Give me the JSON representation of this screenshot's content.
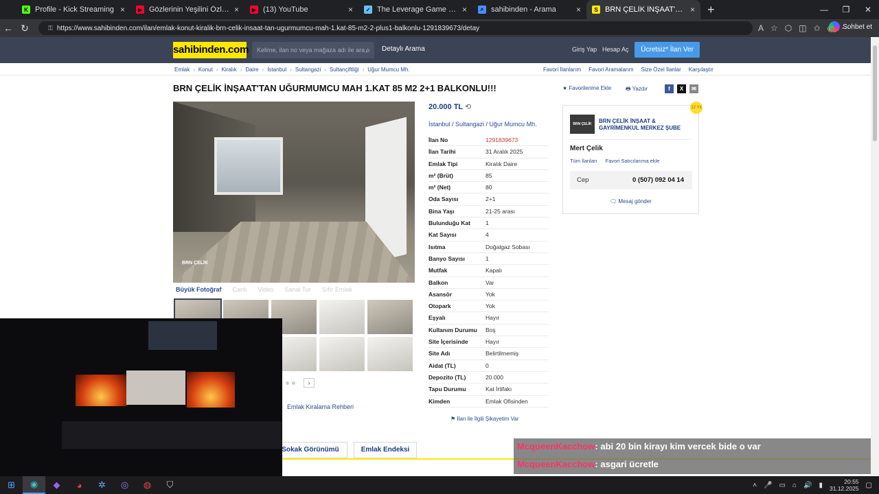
{
  "browser": {
    "tabs": [
      {
        "title": "Profile - Kick Streaming",
        "fav_color": "#53fc18",
        "fav_glyph": "K",
        "active": false
      },
      {
        "title": "Gözlerinin Yeşilini Özledim - Y",
        "fav_color": "#ff0033",
        "fav_glyph": "▶",
        "active": false
      },
      {
        "title": "(13) YouTube",
        "fav_color": "#ff0033",
        "fav_glyph": "▶",
        "active": false
      },
      {
        "title": "The Leverage Game Steam'de",
        "fav_color": "#66c0f4",
        "fav_glyph": "✓",
        "active": false
      },
      {
        "title": "sahibinden - Arama",
        "fav_color": "#4a8cff",
        "fav_glyph": "⌕",
        "active": false
      },
      {
        "title": "BRN ÇELİK İNŞAAT'TAN UĞURMU",
        "fav_color": "#ffe800",
        "fav_glyph": "S",
        "active": true
      }
    ],
    "url": "https://www.sahibinden.com/ilan/emlak-konut-kiralik-brn-celik-insaat-tan-ugurmumcu-mah-1.kat-85-m2-2-plus1-balkonlu-1291839673/detay",
    "copilot_label": "Sohbet et"
  },
  "site": {
    "logo": "sahibinden.com",
    "search_placeholder": "Kelime, ilan no veya mağaza adı ile ara",
    "detailed_search": "Detaylı Arama",
    "login": "Giriş Yap",
    "register": "Hesap Aç",
    "free_ad": "Ücretsiz* İlan Ver",
    "accent": "#ffe800",
    "header_color": "#3b4356"
  },
  "breadcrumb": [
    "Emlak",
    "Konut",
    "Kiralık",
    "Daire",
    "İstanbul",
    "Sultangazi",
    "Sultançiftliği",
    "Uğur Mumcu Mh."
  ],
  "breadcrumb_right": [
    "Favori İlanlarım",
    "Favori Aramalarım",
    "Size Özel İlanlar",
    "Karşılaştır"
  ],
  "listing": {
    "title": "BRN ÇELİK İNŞAAT'TAN UĞURMUMCU MAH 1.KAT 85 M2 2+1 BALKONLU!!!",
    "add_favorite": "Favorilerime Ekle",
    "print": "Yazdır",
    "price": "20.000 TL",
    "location": "İstanbul  /  Sultangazi  /  Uğur Mumcu Mh.",
    "photo_watermark": "BRN ÇELİK",
    "photo_tabs": [
      "Büyük Fotoğraf",
      "Canlı",
      "Video",
      "Sanal Tur",
      "Sıfır Emlak"
    ],
    "rental_guide": "Emlak Kiralama Rehberi",
    "complaint": "İlan ile İlgili Şikayetim Var",
    "specs": [
      {
        "k": "İlan No",
        "v": "1291839673"
      },
      {
        "k": "İlan Tarihi",
        "v": "31 Aralık 2025"
      },
      {
        "k": "Emlak Tipi",
        "v": "Kiralık Daire"
      },
      {
        "k": "m² (Brüt)",
        "v": "85"
      },
      {
        "k": "m² (Net)",
        "v": "80"
      },
      {
        "k": "Oda Sayısı",
        "v": "2+1"
      },
      {
        "k": "Bina Yaşı",
        "v": "21-25 arası"
      },
      {
        "k": "Bulunduğu Kat",
        "v": "1"
      },
      {
        "k": "Kat Sayısı",
        "v": "4"
      },
      {
        "k": "Isıtma",
        "v": "Doğalgaz Sobası"
      },
      {
        "k": "Banyo Sayısı",
        "v": "1"
      },
      {
        "k": "Mutfak",
        "v": "Kapalı"
      },
      {
        "k": "Balkon",
        "v": "Var"
      },
      {
        "k": "Asansör",
        "v": "Yok"
      },
      {
        "k": "Otopark",
        "v": "Yok"
      },
      {
        "k": "Eşyalı",
        "v": "Hayır"
      },
      {
        "k": "Kullanım Durumu",
        "v": "Boş"
      },
      {
        "k": "Site İçerisinde",
        "v": "Hayır"
      },
      {
        "k": "Site Adı",
        "v": "Belirtilmemiş"
      },
      {
        "k": "Aidat (TL)",
        "v": "0"
      },
      {
        "k": "Depozito (TL)",
        "v": "20.000"
      },
      {
        "k": "Tapu Durumu",
        "v": "Kat İrtifakı"
      },
      {
        "k": "Kimden",
        "v": "Emlak Ofisinden"
      }
    ],
    "street_view": "Sokak Görünümü",
    "real_estate_index": "Emlak Endeksi"
  },
  "seller": {
    "store": "BRN ÇELİK İNŞAAT & GAYRİMENKUL MERKEZ ŞUBE",
    "logo_text": "BRN ÇELİK",
    "badge": "12 Yıl",
    "person": "Mert Çelik",
    "all_ads": "Tüm İlanları",
    "fav_seller": "Favori Satıcılarıma ekle",
    "phone_label": "Cep",
    "phone": "0 (507) 092 04 14",
    "message": "Mesaj gönder"
  },
  "chat": [
    {
      "user": "McqueenKacchow",
      "text": ": abi 20 bin kirayı kim vercek bide o var"
    },
    {
      "user": "McqueenKacchow",
      "text": ": asgari ücretle"
    }
  ],
  "taskbar": {
    "time": "20:55",
    "date": "31.12.2025"
  }
}
